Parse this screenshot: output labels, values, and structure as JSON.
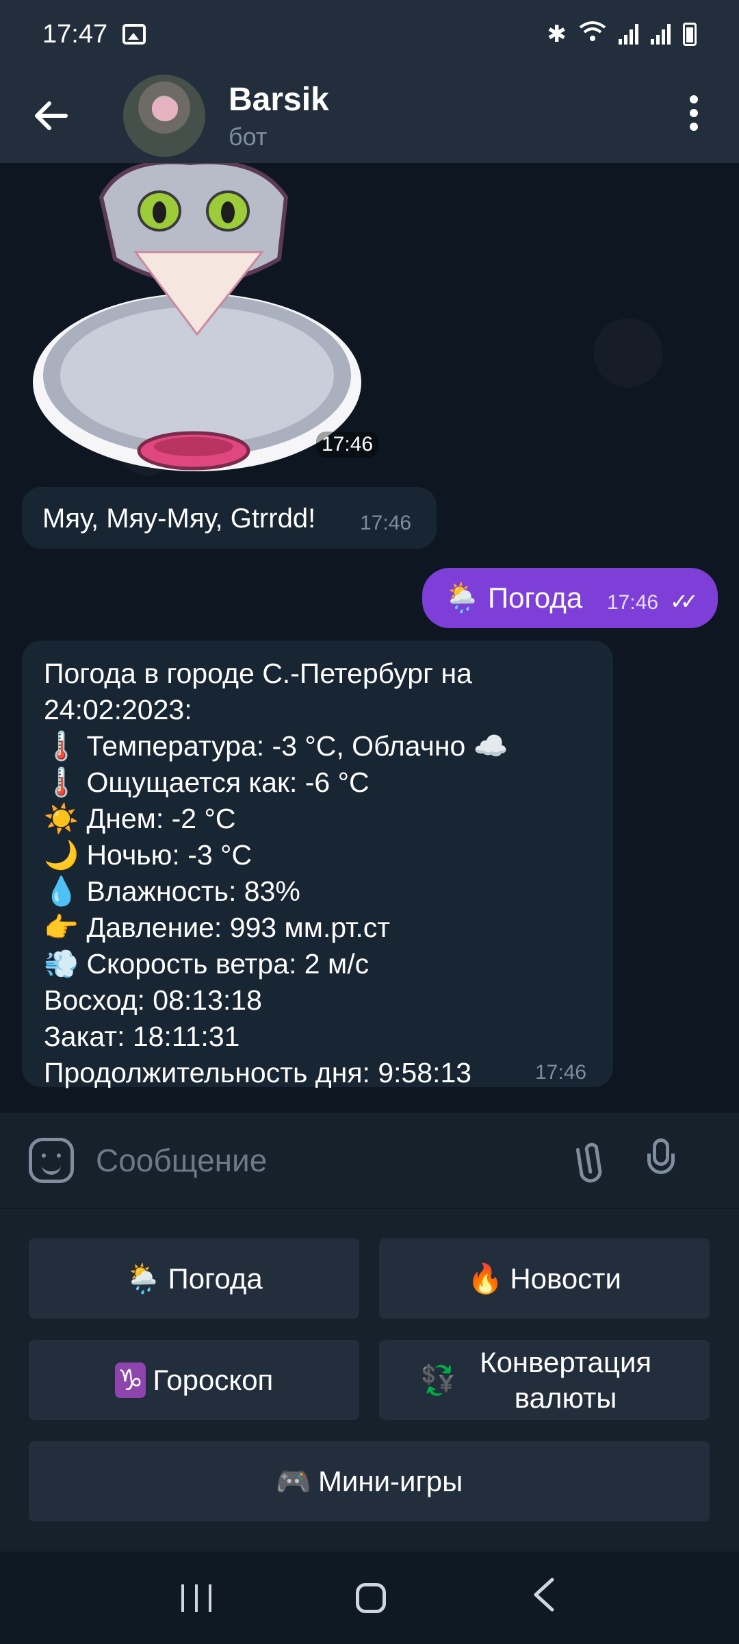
{
  "status_bar": {
    "time": "17:47",
    "icons": [
      "gallery-icon",
      "bluetooth-icon",
      "wifi-icon",
      "signal-icon",
      "signal-icon",
      "battery-icon"
    ]
  },
  "header": {
    "back_icon": "arrow-left-icon",
    "title": "Barsik",
    "subtitle": "бот",
    "menu_icon": "more-vertical-icon"
  },
  "chat": {
    "sticker": {
      "description_icon": "cat-sticker",
      "time": "17:46"
    },
    "msg1": {
      "text": "Мяу, Мяу-Мяу, Gtrrdd!",
      "time": "17:46"
    },
    "out_msg": {
      "emoji": "🌦️",
      "text": "Погода",
      "time": "17:46",
      "status_icon": "double-check-icon"
    },
    "weather": {
      "lines": [
        "Погода в городе С.-Петербург на",
        "24:02:2023:",
        "🌡️ Температура: -3 °С, Облачно ☁️",
        "🌡️ Ощущается как: -6 °С",
        "☀️ Днем: -2 °С",
        "🌙 Ночью: -3 °С",
        "💧 Влажность: 83%",
        "👉 Давление: 993 мм.рт.ст",
        "💨 Скорость ветра: 2 м/с",
        "Восход: 08:13:18",
        "Закат: 18:11:31",
        "Продолжительность дня: 9:58:13"
      ],
      "time": "17:46"
    }
  },
  "input": {
    "placeholder": "Сообщение",
    "icons": [
      "sticker-icon",
      "attach-icon",
      "mic-icon"
    ]
  },
  "keyboard": {
    "weather": {
      "emoji": "🌦️",
      "label": "Погода"
    },
    "news": {
      "emoji": "🔥",
      "label": "Новости"
    },
    "horoscope": {
      "emoji": "♑",
      "label": "Гороскоп"
    },
    "currency": {
      "emoji": "💱",
      "label": "Конвертация валюты"
    },
    "games": {
      "emoji": "🎮",
      "label": "Мини-игры"
    }
  },
  "colors": {
    "header_bg": "#232e3c",
    "chat_bg": "#0e1621",
    "incoming_bubble": "#182533",
    "outgoing_bubble": "#7e3fd8",
    "button_bg": "#232e3c"
  }
}
